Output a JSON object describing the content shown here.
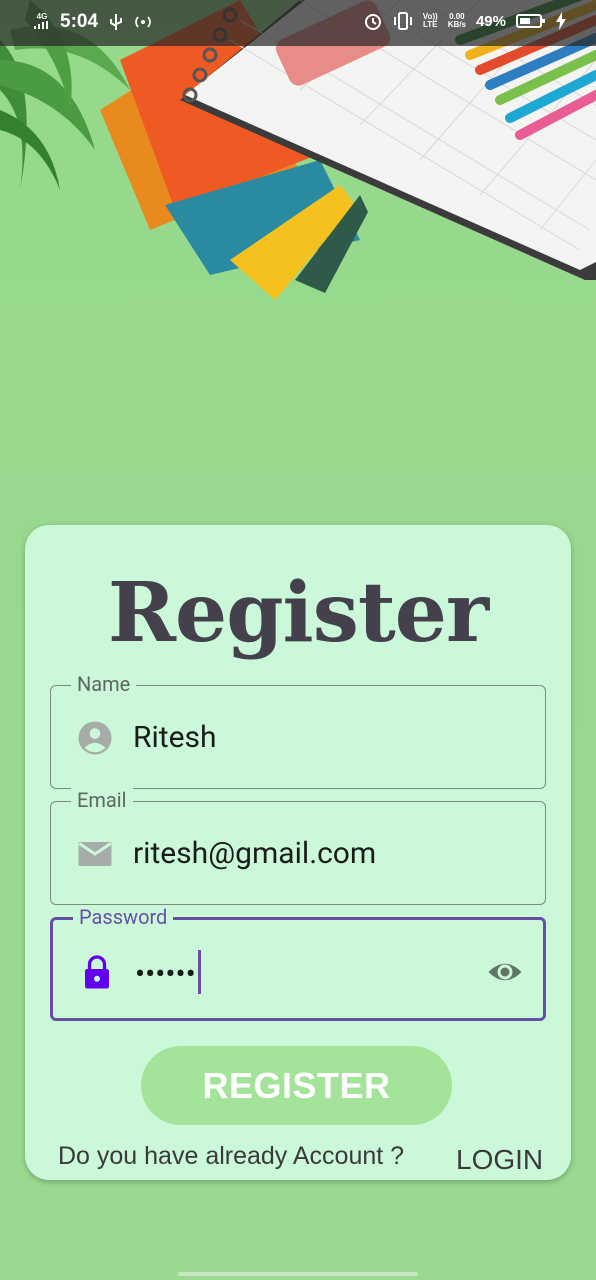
{
  "status_bar": {
    "network": "4G",
    "time": "5:04",
    "volte_top": "Vo))",
    "volte_bottom": "LTE",
    "speed_top": "0.00",
    "speed_bottom": "KB/s",
    "battery": "49%"
  },
  "form": {
    "title": "Register",
    "name_label": "Name",
    "name_value": "Ritesh",
    "email_label": "Email",
    "email_value": "ritesh@gmail.com",
    "password_label": "Password",
    "password_value": "••••••",
    "register_button": "REGISTER",
    "footer_text": "Do you have already Account ?",
    "login_link": "LOGIN"
  },
  "colors": {
    "background": "#98d88e",
    "card": "#ccf8da",
    "accent": "#6750a4",
    "button": "#a3e49a",
    "lock_icon": "#6200ee"
  }
}
